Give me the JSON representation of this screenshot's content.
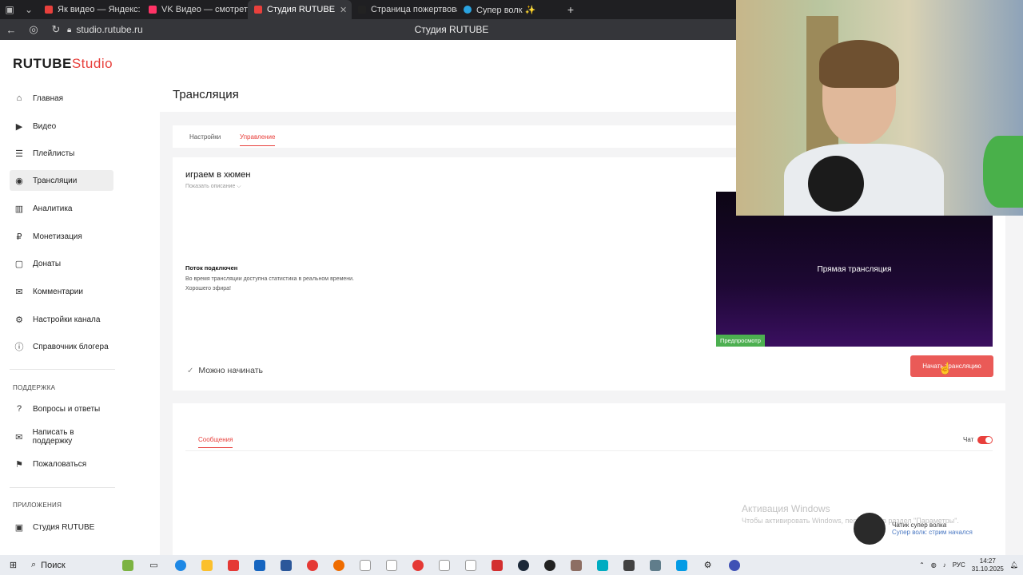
{
  "browser": {
    "tabs": [
      {
        "label": "",
        "icon": "tab-list-icon",
        "color": "#888888"
      },
      {
        "label": "",
        "icon": "chevron-down-icon",
        "color": "#888888"
      },
      {
        "label": "Як видео — Яндекс: наш",
        "icon": "yandex-icon",
        "color": "#e8403c"
      },
      {
        "label": "VK Видео — смотреть он",
        "icon": "vk-video-icon",
        "color": "#ff3366"
      },
      {
        "label": "Студия RUTUBE",
        "icon": "rutube-icon",
        "color": "#e8403c",
        "active": true
      },
      {
        "label": "Страница пожертвовани",
        "icon": "donation-icon",
        "color": "#222222"
      },
      {
        "label": "Супер волк ✨",
        "icon": "telegram-icon",
        "color": "#2aa3e0"
      }
    ],
    "url": "studio.rutube.ru",
    "page_title": "Студия RUTUBE"
  },
  "sidebar": {
    "logo_main": "RUTUBE",
    "logo_studio": "Studio",
    "items": [
      {
        "label": "Главная",
        "icon": "home-icon"
      },
      {
        "label": "Видео",
        "icon": "video-icon"
      },
      {
        "label": "Плейлисты",
        "icon": "playlist-icon"
      },
      {
        "label": "Трансляции",
        "icon": "broadcast-icon"
      },
      {
        "label": "Аналитика",
        "icon": "analytics-icon"
      },
      {
        "label": "Монетизация",
        "icon": "monetization-icon"
      },
      {
        "label": "Донаты",
        "icon": "donate-icon"
      },
      {
        "label": "Комментарии",
        "icon": "comment-icon"
      },
      {
        "label": "Настройки канала",
        "icon": "settings-icon"
      },
      {
        "label": "Справочник блогера",
        "icon": "book-icon"
      }
    ],
    "support_label": "ПОДДЕРЖКА",
    "support_items": [
      {
        "label": "Вопросы и ответы",
        "icon": "faq-icon"
      },
      {
        "label": "Написать в поддержку",
        "icon": "mail-icon"
      },
      {
        "label": "Пожаловаться",
        "icon": "flag-icon"
      }
    ],
    "apps_label": "ПРИЛОЖЕНИЯ",
    "apps_items": [
      {
        "label": "Студия RUTUBE",
        "icon": "rutube-studio-app-icon"
      }
    ]
  },
  "main": {
    "title": "Трансляция",
    "tabs": [
      "Настройки",
      "Управление"
    ],
    "active_tab": "Управление",
    "stream_name": "играем в хюмен",
    "show_description": "Показать описание ⌵",
    "status_title": "Поток подключен",
    "status_text_1": "Во время трансляции доступна статистика в реальном времени.",
    "status_text_2": "Хорошего эфира!",
    "ready_label": "Можно начинать",
    "preview_text": "Прямая трансляция",
    "preview_badge": "Предпросмотр",
    "start_button": "Начать трансляцию"
  },
  "chat": {
    "tab_label": "Сообщения",
    "toggle_label": "Чат",
    "toggle_on": true
  },
  "watermark": {
    "line1": "Активация Windows",
    "line2": "Чтобы активировать Windows, перейдите в раздел \"Параметры\"."
  },
  "notification": {
    "title": "Чатик супер волка",
    "body": "Супер волк: стрим начался"
  },
  "taskbar": {
    "search": "Поиск",
    "language": "РУС",
    "time": "14:27",
    "date": "31.10.2025"
  },
  "colors": {
    "accent": "#e8403c",
    "success": "#4caf50"
  }
}
